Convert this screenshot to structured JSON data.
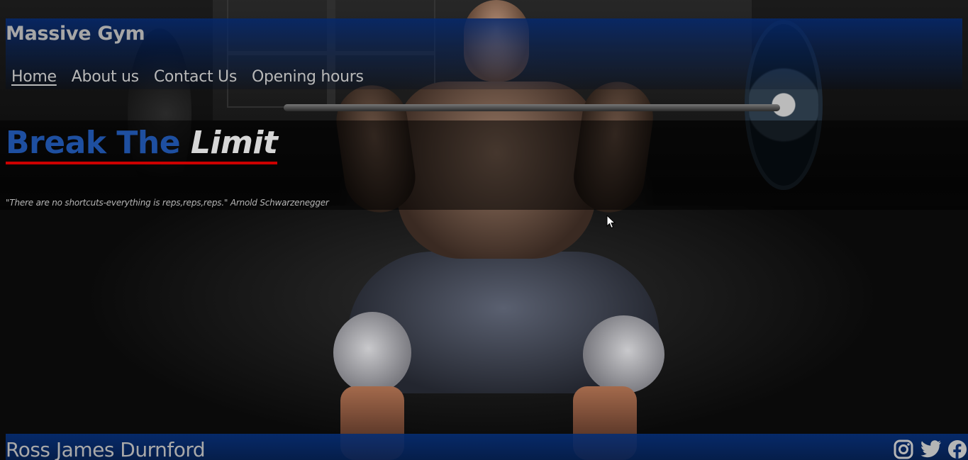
{
  "site": {
    "title": "Massive Gym"
  },
  "nav": {
    "items": [
      {
        "label": "Home",
        "active": true
      },
      {
        "label": "About us",
        "active": false
      },
      {
        "label": "Contact Us",
        "active": false
      },
      {
        "label": "Opening hours",
        "active": false
      }
    ]
  },
  "hero": {
    "heading_part1": "Break The ",
    "heading_part2": "Limit",
    "quote": "\"There are no shortcuts-everything is reps,reps,reps.\" Arnold Schwarzenegger"
  },
  "footer": {
    "name": "Ross James Durnford",
    "social_icons": [
      "instagram-icon",
      "twitter-icon",
      "facebook-icon"
    ]
  },
  "colors": {
    "header_blue": "#04286e",
    "heading_blue": "#1e4fa0",
    "underline_red": "#cc0000",
    "text_grey": "#a6a6a6"
  }
}
